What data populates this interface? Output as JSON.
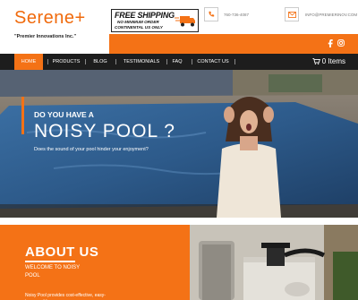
{
  "header": {
    "logo_text": "Serene",
    "logo_plus": "+",
    "tagline": "\"Premier Innovations Inc.\"",
    "shipping": {
      "title": "FREE SHIPPING",
      "line1": "NO MINIMUM ORDER",
      "line2": "CONTINENTAL US ONLY"
    },
    "phone": "760-736-4087",
    "email": "INFO@PREMIERINOV.COM",
    "phone_icon": "phone-icon",
    "email_icon": "envelope-icon",
    "social": [
      "facebook-icon",
      "instagram-icon"
    ]
  },
  "nav": {
    "items": [
      "HOME",
      "PRODUCTS",
      "BLOG",
      "TESTIMONIALS",
      "FAQ",
      "CONTACT US"
    ],
    "cart": "0 Items"
  },
  "hero": {
    "pre_title": "DO YOU HAVE A",
    "title": "NOISY POOL ?",
    "subtitle": "Does the sound of your pool hinder your enjoyment?"
  },
  "about": {
    "title": "ABOUT US",
    "subtitle": "WELCOME TO NOISY POOL",
    "description": "Noisy Pool provides cost-effective, easy-to-assemble,"
  },
  "colors": {
    "accent": "#f47216",
    "nav_bg": "#1d1d1d",
    "text_dark": "#222222"
  }
}
